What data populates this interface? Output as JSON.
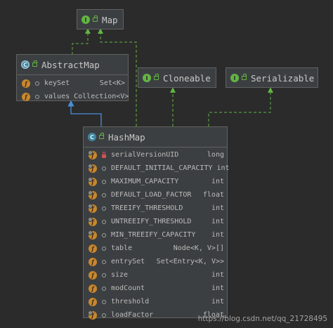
{
  "colors": {
    "background": "#2b2b2b",
    "node_fill": "#3c3f41",
    "node_border": "#616161",
    "implements_line": "#62b543",
    "extends_line": "#4a8fd8",
    "field_icon": "#c9872e",
    "private_icon": "#d25252"
  },
  "nodes": {
    "map": {
      "name": "Map",
      "kind": "interface",
      "kind_icon": "I"
    },
    "abstract_map": {
      "name": "AbstractMap",
      "kind": "abstract-class",
      "kind_icon": "C",
      "members": [
        {
          "name": "keySet",
          "type": "Set<K>",
          "visibility": "package",
          "static": false
        },
        {
          "name": "values",
          "type": "Collection<V>",
          "visibility": "package",
          "static": false
        }
      ]
    },
    "cloneable": {
      "name": "Cloneable",
      "kind": "interface",
      "kind_icon": "I"
    },
    "serializable": {
      "name": "Serializable",
      "kind": "interface",
      "kind_icon": "I"
    },
    "hash_map": {
      "name": "HashMap",
      "kind": "class",
      "kind_icon": "C",
      "members": [
        {
          "name": "serialVersionUID",
          "type": "long",
          "visibility": "private",
          "static": true
        },
        {
          "name": "DEFAULT_INITIAL_CAPACITY",
          "type": "int",
          "visibility": "package",
          "static": true
        },
        {
          "name": "MAXIMUM_CAPACITY",
          "type": "int",
          "visibility": "package",
          "static": true
        },
        {
          "name": "DEFAULT_LOAD_FACTOR",
          "type": "float",
          "visibility": "package",
          "static": true
        },
        {
          "name": "TREEIFY_THRESHOLD",
          "type": "int",
          "visibility": "package",
          "static": true
        },
        {
          "name": "UNTREEIFY_THRESHOLD",
          "type": "int",
          "visibility": "package",
          "static": true
        },
        {
          "name": "MIN_TREEIFY_CAPACITY",
          "type": "int",
          "visibility": "package",
          "static": true
        },
        {
          "name": "table",
          "type": "Node<K, V>[]",
          "visibility": "package",
          "static": false
        },
        {
          "name": "entrySet",
          "type": "Set<Entry<K, V>>",
          "visibility": "package",
          "static": false
        },
        {
          "name": "size",
          "type": "int",
          "visibility": "package",
          "static": false
        },
        {
          "name": "modCount",
          "type": "int",
          "visibility": "package",
          "static": false
        },
        {
          "name": "threshold",
          "type": "int",
          "visibility": "package",
          "static": false
        },
        {
          "name": "loadFactor",
          "type": "float",
          "visibility": "package",
          "static": true
        }
      ]
    }
  },
  "edges": [
    {
      "from": "abstract_map",
      "to": "map",
      "relation": "implements"
    },
    {
      "from": "hash_map",
      "to": "map",
      "relation": "implements"
    },
    {
      "from": "hash_map",
      "to": "abstract_map",
      "relation": "extends"
    },
    {
      "from": "hash_map",
      "to": "cloneable",
      "relation": "implements"
    },
    {
      "from": "hash_map",
      "to": "serializable",
      "relation": "implements"
    }
  ],
  "watermark": "https://blog.csdn.net/qq_21728495"
}
